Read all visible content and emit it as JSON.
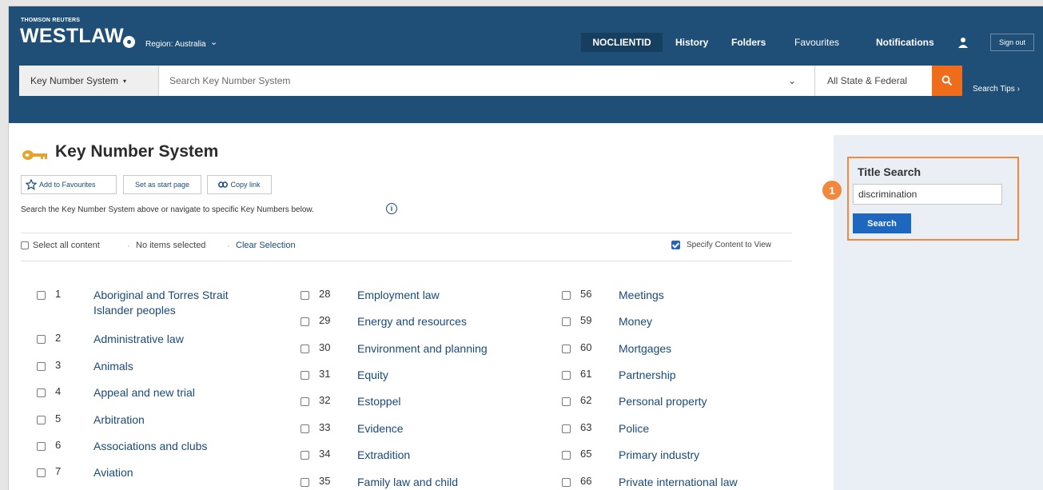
{
  "header": {
    "brand_small": "THOMSON REUTERS",
    "brand_name": "WESTLAW",
    "region_label": "Region: Australia",
    "nav": {
      "client_id": "NOCLIENTID",
      "history": "History",
      "folders": "Folders",
      "favourites": "Favourites",
      "notifications": "Notifications",
      "sign_out": "Sign out"
    },
    "search": {
      "scope_label": "Key Number System",
      "placeholder": "Search Key Number System",
      "jurisdiction": "All State & Federal",
      "tips": "Search Tips"
    }
  },
  "main": {
    "title": "Key Number System",
    "actions": {
      "add_favourites": "Add to Favourites",
      "set_start": "Set as start page",
      "copy_link": "Copy link"
    },
    "hint": "Search the Key Number System above or navigate to specific Key Numbers below.",
    "selection": {
      "select_all": "Select all content",
      "no_items": "No items selected",
      "clear": "Clear Selection",
      "specify": "Specify Content to View"
    },
    "topics_col1": [
      {
        "num": "1",
        "label": "Aboriginal and Torres Strait Islander peoples"
      },
      {
        "num": "2",
        "label": "Administrative law"
      },
      {
        "num": "3",
        "label": "Animals"
      },
      {
        "num": "4",
        "label": "Appeal and new trial"
      },
      {
        "num": "5",
        "label": "Arbitration"
      },
      {
        "num": "6",
        "label": "Associations and clubs"
      },
      {
        "num": "7",
        "label": "Aviation"
      }
    ],
    "topics_col2": [
      {
        "num": "28",
        "label": "Employment law"
      },
      {
        "num": "29",
        "label": "Energy and resources"
      },
      {
        "num": "30",
        "label": "Environment and planning"
      },
      {
        "num": "31",
        "label": "Equity"
      },
      {
        "num": "32",
        "label": "Estoppel"
      },
      {
        "num": "33",
        "label": "Evidence"
      },
      {
        "num": "34",
        "label": "Extradition"
      },
      {
        "num": "35",
        "label": "Family law and child"
      }
    ],
    "topics_col3": [
      {
        "num": "56",
        "label": "Meetings"
      },
      {
        "num": "59",
        "label": "Money"
      },
      {
        "num": "60",
        "label": "Mortgages"
      },
      {
        "num": "61",
        "label": "Partnership"
      },
      {
        "num": "62",
        "label": "Personal property"
      },
      {
        "num": "63",
        "label": "Police"
      },
      {
        "num": "65",
        "label": "Primary industry"
      },
      {
        "num": "66",
        "label": "Private international law"
      }
    ]
  },
  "side": {
    "title": "Title Search",
    "input_value": "discrimination",
    "button": "Search",
    "callout": "1"
  },
  "colors": {
    "header_bg": "#1f4f76",
    "accent_orange": "#ef6c1b",
    "link_blue": "#1a4a79",
    "button_blue": "#1d67be",
    "panel_bg": "#e9eff5"
  }
}
